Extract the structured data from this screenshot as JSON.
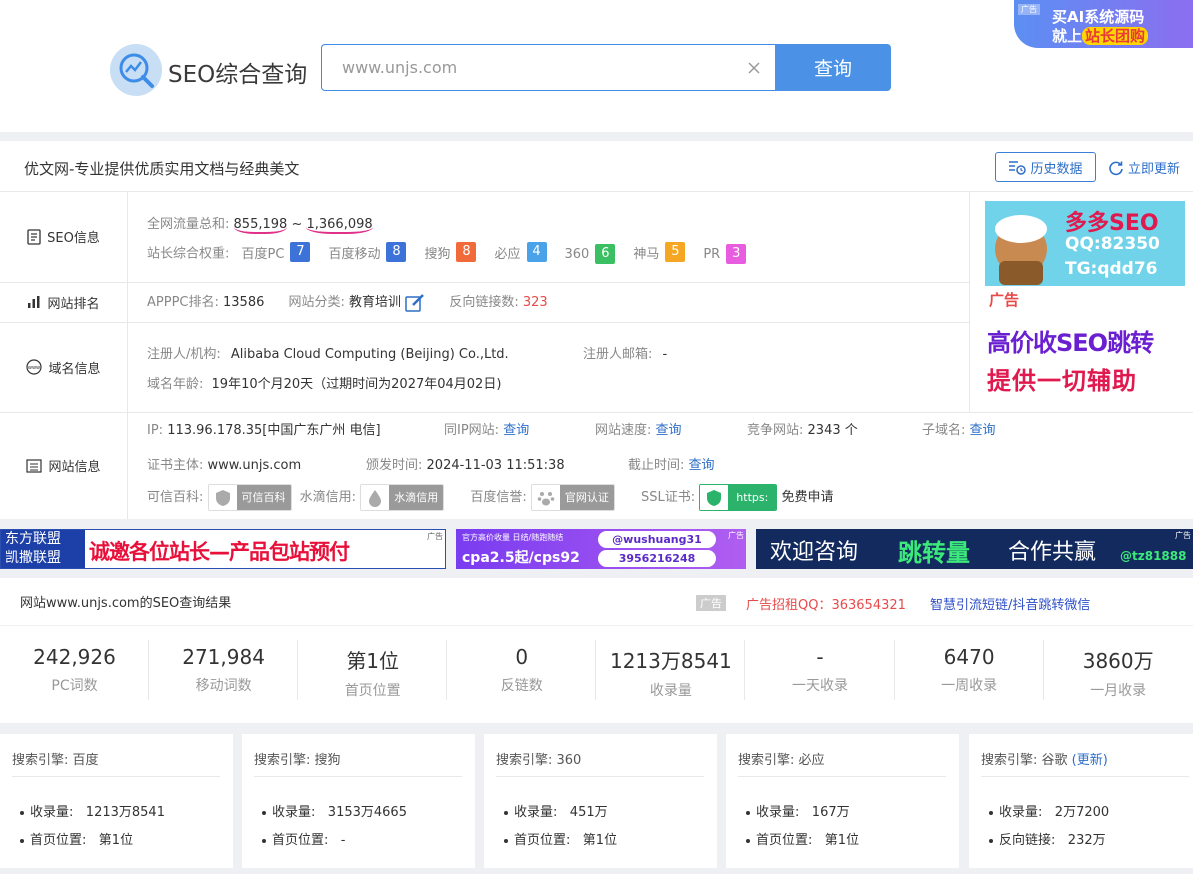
{
  "header": {
    "logo_text": "SEO综合查询",
    "search_value": "www.unjs.com",
    "search_button": "查询",
    "ad_tag": "广告",
    "ad_line1": "买AI系统源码",
    "ad_line2_prefix": "就上",
    "ad_line2_highlight": "站长团购"
  },
  "site": {
    "title": "优文网-专业提供优质实用文档与经典美文",
    "history_button": "历史数据",
    "update_button": "立即更新"
  },
  "seo_info": {
    "label": "SEO信息",
    "traffic_label": "全网流量总和:",
    "traffic_low": "855,198",
    "traffic_sep": "~",
    "traffic_high": "1,366,098",
    "weight_label": "站长综合权重:",
    "weights": [
      {
        "name": "百度PC",
        "value": "7",
        "color": "#3d73d8"
      },
      {
        "name": "百度移动",
        "value": "8",
        "color": "#3d73d8"
      },
      {
        "name": "搜狗",
        "value": "8",
        "color": "#f06a3a"
      },
      {
        "name": "必应",
        "value": "4",
        "color": "#4aa3e8"
      },
      {
        "name": "360",
        "value": "6",
        "color": "#3bbf63"
      },
      {
        "name": "神马",
        "value": "5",
        "color": "#f5a623"
      },
      {
        "name": "PR",
        "value": "3",
        "color": "#e85ce0"
      }
    ]
  },
  "ranking": {
    "label": "网站排名",
    "apppc_label": "APPPC排名:",
    "apppc_value": "13586",
    "category_label": "网站分类:",
    "category_value": "教育培训",
    "backlink_label": "反向链接数:",
    "backlink_value": "323"
  },
  "domain": {
    "label": "域名信息",
    "registrant_label": "注册人/机构:",
    "registrant_value": "Alibaba Cloud Computing (Beijing) Co.,Ltd.",
    "email_label": "注册人邮箱:",
    "email_value": "-",
    "age_label": "域名年龄:",
    "age_value": "19年10个月20天（过期时间为2027年04月02日)"
  },
  "website": {
    "label": "网站信息",
    "ip_label": "IP:",
    "ip_value": "113.96.178.35[中国广东广州 电信]",
    "sameip_label": "同IP网站:",
    "sameip_value": "查询",
    "speed_label": "网站速度:",
    "speed_value": "查询",
    "compete_label": "竞争网站:",
    "compete_value": "2343 个",
    "subdomain_label": "子域名:",
    "subdomain_value": "查询",
    "cert_label": "证书主体:",
    "cert_value": "www.unjs.com",
    "issue_label": "颁发时间:",
    "issue_value": "2024-11-03 11:51:38",
    "expire_label": "截止时间:",
    "expire_value": "查询",
    "baike_label": "可信百科:",
    "baike_pill": "可信百科",
    "water_label": "水滴信用:",
    "water_pill": "水滴信用",
    "baidu_label": "百度信誉:",
    "baidu_pill": "官网认证",
    "ssl_label": "SSL证书:",
    "ssl_pill": "https:",
    "ssl_free": "免费申请"
  },
  "side_ad": {
    "line1": "多多SEO",
    "qq": "QQ:82350",
    "tg": "TG:qdd76",
    "tag": "广告",
    "line2": "高价收SEO跳转",
    "line3": "提供一切辅助"
  },
  "banners": [
    {
      "left_top": "东方联盟",
      "left_bottom": "凯撒联盟",
      "main": "诚邀各位站长—产品包站预付",
      "tag": "广告"
    },
    {
      "top": "官方高价收量 日结/随跑随结",
      "bottom": "cpa2.5起/cps92",
      "handle": "@wushuang31",
      "number": "3956216248",
      "tag": "广告"
    },
    {
      "text1": "欢迎咨询",
      "text2": "跳转量",
      "text3": "合作共赢",
      "handle": "@tz81888",
      "tag": "广告"
    }
  ],
  "results": {
    "heading": "网站www.unjs.com的SEO查询结果",
    "ad_tag": "广告",
    "ad_text": "广告招租QQ：363654321",
    "link_text": "智慧引流短链/抖音跳转微信",
    "stats": [
      {
        "value": "242,926",
        "label": "PC词数"
      },
      {
        "value": "271,984",
        "label": "移动词数"
      },
      {
        "value": "第1位",
        "label": "首页位置"
      },
      {
        "value": "0",
        "label": "反链数"
      },
      {
        "value": "1213万8541",
        "label": "收录量"
      },
      {
        "value": "-",
        "label": "一天收录"
      },
      {
        "value": "6470",
        "label": "一周收录"
      },
      {
        "value": "3860万",
        "label": "一月收录"
      }
    ]
  },
  "engines": [
    {
      "title": "搜索引擎: 百度",
      "extra": "",
      "r1_label": "收录量:",
      "r1_value": "1213万8541",
      "r2_label": "首页位置:",
      "r2_value": "第1位"
    },
    {
      "title": "搜索引擎: 搜狗",
      "extra": "",
      "r1_label": "收录量:",
      "r1_value": "3153万4665",
      "r2_label": "首页位置:",
      "r2_value": "-"
    },
    {
      "title": "搜索引擎: 360",
      "extra": "",
      "r1_label": "收录量:",
      "r1_value": "451万",
      "r2_label": "首页位置:",
      "r2_value": "第1位"
    },
    {
      "title": "搜索引擎: 必应",
      "extra": "",
      "r1_label": "收录量:",
      "r1_value": "167万",
      "r2_label": "首页位置:",
      "r2_value": "第1位"
    },
    {
      "title": "搜索引擎: 谷歌",
      "extra": "(更新)",
      "r1_label": "收录量:",
      "r1_value": "2万7200",
      "r2_label": "反向链接:",
      "r2_value": "232万"
    }
  ]
}
